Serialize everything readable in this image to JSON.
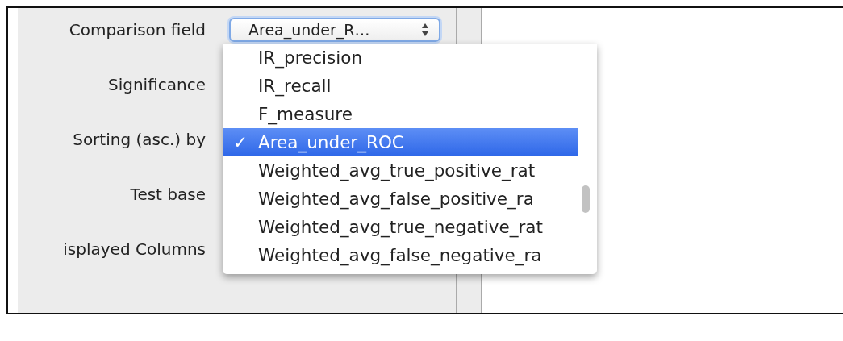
{
  "form": {
    "rows": [
      {
        "label": "Comparison field",
        "kind": "select",
        "value": "Area_under_R…"
      },
      {
        "label": "Significance",
        "kind": "hidden"
      },
      {
        "label": "Sorting (asc.) by",
        "kind": "hidden"
      },
      {
        "label": "Test base",
        "kind": "hidden"
      },
      {
        "label": "isplayed Columns",
        "kind": "hidden"
      }
    ]
  },
  "dropdown": {
    "items": [
      {
        "label": "IR_precision",
        "selected": false
      },
      {
        "label": "IR_recall",
        "selected": false
      },
      {
        "label": "F_measure",
        "selected": false
      },
      {
        "label": "Area_under_ROC",
        "selected": true
      },
      {
        "label": "Weighted_avg_true_positive_rat",
        "selected": false
      },
      {
        "label": "Weighted_avg_false_positive_ra",
        "selected": false
      },
      {
        "label": "Weighted_avg_true_negative_rat",
        "selected": false
      },
      {
        "label": "Weighted_avg_false_negative_ra",
        "selected": false
      }
    ],
    "check_mark": "✓"
  }
}
